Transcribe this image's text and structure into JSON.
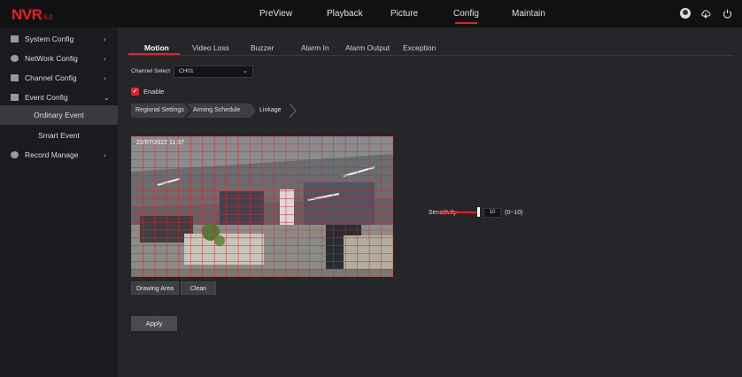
{
  "app": {
    "logo": "NVR",
    "version": "6.0"
  },
  "top_nav": {
    "items": [
      {
        "label": "PreView"
      },
      {
        "label": "Playback"
      },
      {
        "label": "Picture"
      },
      {
        "label": "Config"
      },
      {
        "label": "Maintain"
      }
    ],
    "active": "Config",
    "icons": [
      "user-icon",
      "cloud-icon",
      "power-icon"
    ]
  },
  "sidebar": {
    "items": [
      {
        "label": "System Config",
        "icon": "system-config-icon",
        "chevron": "›"
      },
      {
        "label": "NetWork Config",
        "icon": "network-icon",
        "chevron": "›"
      },
      {
        "label": "Channel Config",
        "icon": "camera-icon",
        "chevron": "›"
      },
      {
        "label": "Event Config",
        "icon": "event-icon",
        "chevron": "⌄"
      },
      {
        "label": "Record Manage",
        "icon": "record-icon",
        "chevron": "›"
      }
    ],
    "sub_items": [
      {
        "label": "Ordinary Event"
      },
      {
        "label": "Smart Event"
      }
    ],
    "active_sub": "Ordinary Event"
  },
  "tabs": {
    "items": [
      {
        "label": "Motion"
      },
      {
        "label": "Video Loss"
      },
      {
        "label": "Buzzer"
      },
      {
        "label": "Alarm In"
      },
      {
        "label": "Alarm Output"
      },
      {
        "label": "Exception"
      }
    ],
    "active": "Motion"
  },
  "channel_select": {
    "label": "Channel Select",
    "value": "CH01"
  },
  "enable": {
    "label": "Enable",
    "checked": true
  },
  "steps": {
    "items": [
      {
        "label": "Regional Settings"
      },
      {
        "label": "Arming Schedule"
      },
      {
        "label": "Linkage"
      }
    ]
  },
  "video": {
    "timestamp": "22/07/2022 11:37"
  },
  "sensitivity": {
    "label": "Sensitivity",
    "value": "10",
    "range": "(0~10)",
    "level_fraction": 1.0
  },
  "buttons": {
    "drawing_area": "Drawing Area",
    "clean": "Clean",
    "apply": "Apply"
  },
  "colors": {
    "accent": "#e61f2c",
    "background": "#25262a",
    "sidebar": "#1a1b1e",
    "topbar": "#101113"
  }
}
